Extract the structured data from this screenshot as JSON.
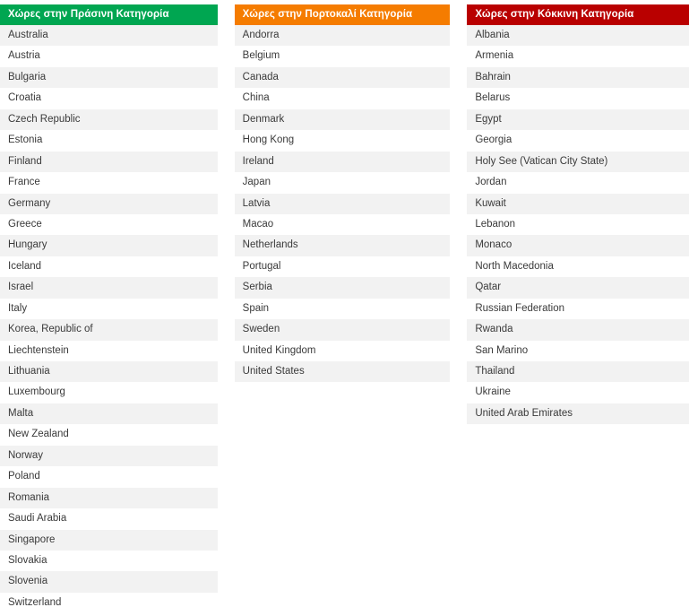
{
  "columns": [
    {
      "id": "green-category",
      "header": "Χώρες στην Πράσινη Κατηγορία",
      "accent": "#00a651",
      "items": [
        "Australia",
        "Austria",
        "Bulgaria",
        "Croatia",
        "Czech Republic",
        "Estonia",
        "Finland",
        "France",
        "Germany",
        "Greece",
        "Hungary",
        "Iceland",
        "Israel",
        "Italy",
        "Korea, Republic of",
        "Liechtenstein",
        "Lithuania",
        "Luxembourg",
        "Malta",
        "New Zealand",
        "Norway",
        "Poland",
        "Romania",
        "Saudi Arabia",
        "Singapore",
        "Slovakia",
        "Slovenia",
        "Switzerland"
      ]
    },
    {
      "id": "orange-category",
      "header": "Χώρες στην Πορτοκαλί Κατηγορία",
      "accent": "#f57c00",
      "items": [
        "Andorra",
        "Belgium",
        "Canada",
        "China",
        "Denmark",
        "Hong Kong",
        "Ireland",
        "Japan",
        "Latvia",
        "Macao",
        "Netherlands",
        "Portugal",
        "Serbia",
        "Spain",
        "Sweden",
        "United Kingdom",
        "United States"
      ]
    },
    {
      "id": "red-category",
      "header": "Χώρες στην Κόκκινη Κατηγορία",
      "accent": "#b90000",
      "items": [
        "Albania",
        "Armenia",
        "Bahrain",
        "Belarus",
        "Egypt",
        "Georgia",
        "Holy See (Vatican City State)",
        "Jordan",
        "Kuwait",
        "Lebanon",
        "Monaco",
        "North Macedonia",
        "Qatar",
        "Russian Federation",
        "Rwanda",
        "San Marino",
        "Thailand",
        "Ukraine",
        "United Arab Emirates"
      ]
    }
  ]
}
